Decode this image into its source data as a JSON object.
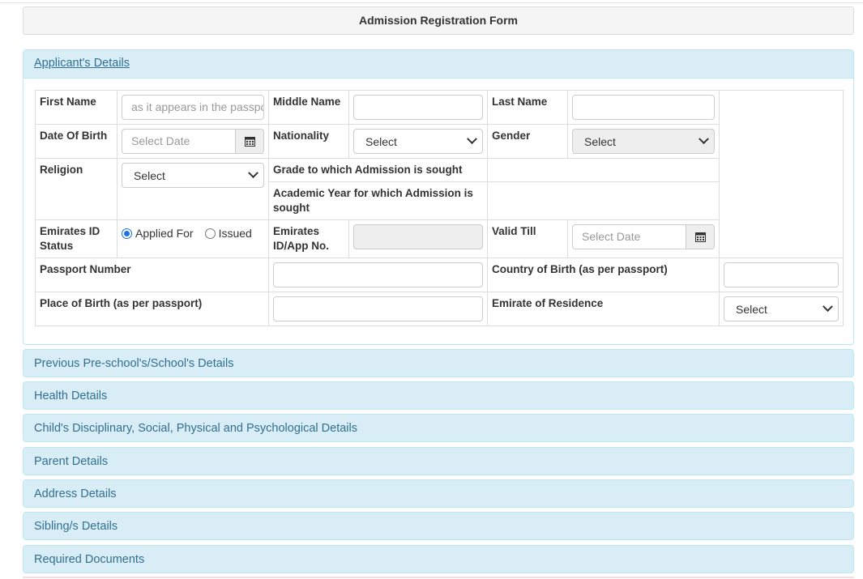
{
  "form": {
    "title": "Admission Registration Form"
  },
  "applicant": {
    "heading": "Applicant's Details",
    "first_name_label": "First Name",
    "first_name_placeholder": "as it appears in the passport",
    "middle_name_label": "Middle Name",
    "last_name_label": "Last Name",
    "dob_label": "Date Of Birth",
    "date_placeholder": "Select Date",
    "nationality_label": "Nationality",
    "nationality_value": "Select",
    "gender_label": "Gender",
    "gender_value": "Select",
    "religion_label": "Religion",
    "religion_value": "Select",
    "grade_label": "Grade to which Admission is sought",
    "academic_year_label": "Academic Year for which Admission is sought",
    "eid_status_label": "Emirates ID Status",
    "eid_applied_label": "Applied For",
    "eid_issued_label": "Issued",
    "eid_selected": "Applied For",
    "eid_no_label": "Emirates ID/App No.",
    "valid_till_label": "Valid Till",
    "passport_label": "Passport Number",
    "country_birth_label": "Country of Birth (as per passport)",
    "place_birth_label": "Place of Birth (as per passport)",
    "emirate_label": "Emirate of Residence",
    "emirate_value": "Select"
  },
  "sections": [
    "Previous Pre-school's/School's Details",
    "Health Details",
    "Child's Disciplinary, Social, Physical and Psychological Details",
    "Parent Details",
    "Address Details",
    "Sibling/s Details",
    "Required Documents"
  ],
  "icons": {
    "calendar": "calendar-icon",
    "dropdown": "chevron-down-icon"
  },
  "colors": {
    "panel_bg": "#d9edf7",
    "panel_border": "#bce8f1",
    "panel_text": "#31708f",
    "radio_accent": "#1a73e8"
  }
}
